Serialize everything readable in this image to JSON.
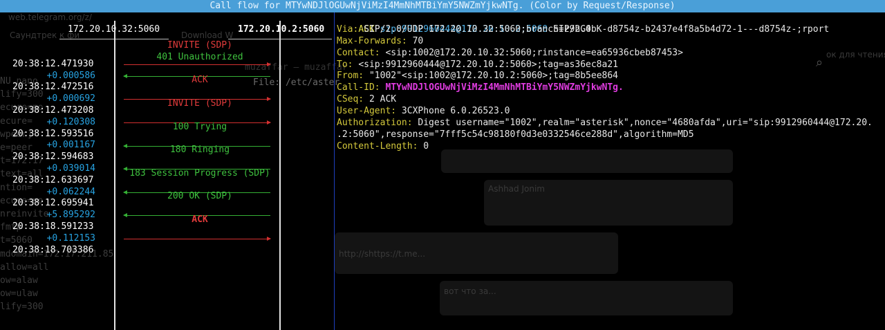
{
  "window_title": "Call flow for MTYwNDJlOGUwNjViMzI4MmNhMTBiYmY5NWZmYjkwNTg. (Color by Request/Response)",
  "background": {
    "url_fragment": "web.telegram.org/z/",
    "bookmark_1": "Саундтрек к фи",
    "bookmark_2": "Download W",
    "bookmark_3": "ок для чтения",
    "file_label": "File: /etc/aster",
    "contact_line": "muzaffar — muzaffar",
    "left_config": [
      "NU nano",
      "lify=300",
      "ecure=no",
      "ecure=",
      "wpeer]",
      "e=peer",
      "t=172.17",
      "text=all",
      "ntion=",
      "ecure=no",
      "nreinvite",
      "fmtp",
      "t=5060",
      "mdomain=172.17.211.85",
      "allow=all",
      "ow=alaw",
      "ow=ulaw",
      "lify=300"
    ],
    "chat_title": "Ashhad Jonim",
    "chat_link": "http://shttps://t.me...",
    "chat_text": "вот что за..."
  },
  "hosts": {
    "left": "172.20.10.32:5060",
    "right": "172.20.10.2:5060"
  },
  "flow": [
    {
      "time": "",
      "label": "INVITE (SDP)",
      "kind": "req"
    },
    {
      "time": "20:38:12.471930",
      "label": "401 Unauthorized",
      "kind": "resp"
    },
    {
      "time": "+0.000586",
      "label": "",
      "kind": "delta"
    },
    {
      "time": "20:38:12.472516",
      "label": "ACK",
      "kind": "req"
    },
    {
      "time": "+0.000692",
      "label": "",
      "kind": "delta"
    },
    {
      "time": "20:38:12.473208",
      "label": "INVITE (SDP)",
      "kind": "req"
    },
    {
      "time": "+0.120308",
      "label": "",
      "kind": "delta"
    },
    {
      "time": "20:38:12.593516",
      "label": "100 Trying",
      "kind": "resp"
    },
    {
      "time": "+0.001167",
      "label": "",
      "kind": "delta"
    },
    {
      "time": "20:38:12.594683",
      "label": "180 Ringing",
      "kind": "resp"
    },
    {
      "time": "+0.039014",
      "label": "",
      "kind": "delta"
    },
    {
      "time": "20:38:12.633697",
      "label": "183 Session Progress (SDP)",
      "kind": "resp"
    },
    {
      "time": "+0.062244",
      "label": "",
      "kind": "delta"
    },
    {
      "time": "20:38:12.695941",
      "label": "200 OK (SDP)",
      "kind": "resp"
    },
    {
      "time": "+5.895292",
      "label": "",
      "kind": "delta"
    },
    {
      "time": "20:38:18.591233",
      "label": "ACK",
      "kind": "req"
    },
    {
      "time": "+0.112153",
      "label": "",
      "kind": "delta"
    },
    {
      "time": "20:38:18.703386",
      "label": "",
      "kind": "ts"
    }
  ],
  "detail": {
    "start_method": "ACK",
    "start_uri": "sip:9912960444@172.20.10.2:5060",
    "start_version": "SIP/2.0",
    "headers": [
      {
        "name": "Via:",
        "value": "SIP/2.0/UDP 172.20.10.32:5060;branch=z9hG4bK-d8754z-b2437e4f8a5b4d72-1---d8754z-;rport"
      },
      {
        "name": "Max-Forwards:",
        "value": "70"
      },
      {
        "name": "Contact:",
        "value": "<sip:1002@172.20.10.32:5060;rinstance=ea65936cbeb87453>"
      },
      {
        "name": "To:",
        "value": "<sip:9912960444@172.20.10.2:5060>;tag=as36ec8a21"
      },
      {
        "name": "From:",
        "value": "\"1002\"<sip:1002@172.20.10.2:5060>;tag=8b5ee864"
      },
      {
        "name": "Call-ID:",
        "value": "MTYwNDJlOGUwNjViMzI4MmNhMTBiYmY5NWZmYjkwNTg.",
        "highlight": true
      },
      {
        "name": "CSeq:",
        "value": "2 ACK"
      },
      {
        "name": "User-Agent:",
        "value": "3CXPhone 6.0.26523.0"
      },
      {
        "name": "Authorization:",
        "value": "Digest username=\"1002\",realm=\"asterisk\",nonce=\"4680afda\",uri=\"sip:9912960444@172.20."
      },
      {
        "name": "",
        "value": ".2:5060\",response=\"7fff5c54c98180f0d3e0332546ce288d\",algorithm=MD5"
      },
      {
        "name": "Content-Length:",
        "value": "0"
      }
    ]
  }
}
